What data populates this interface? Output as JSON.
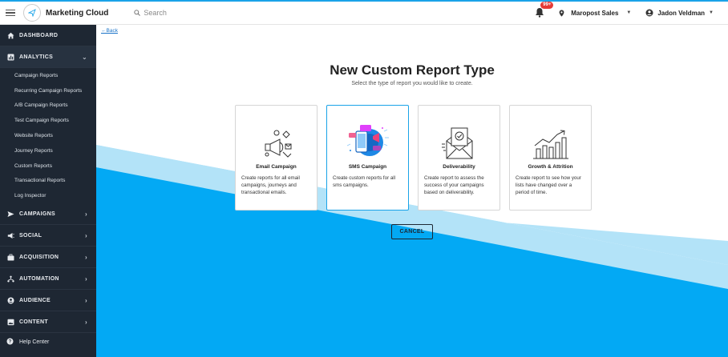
{
  "topbar": {
    "app_title": "Marketing Cloud",
    "search_placeholder": "Search",
    "notification_count": "99+",
    "account_name": "Maropost Sales",
    "user_name": "Jadon Veldman"
  },
  "sidebar": {
    "groups": [
      {
        "label": "DASHBOARD",
        "icon": "home-icon"
      },
      {
        "label": "ANALYTICS",
        "icon": "chart-icon",
        "expanded": true
      },
      {
        "label": "CAMPAIGNS",
        "icon": "send-icon"
      },
      {
        "label": "SOCIAL",
        "icon": "megaphone-icon"
      },
      {
        "label": "ACQUISITION",
        "icon": "briefcase-icon"
      },
      {
        "label": "AUTOMATION",
        "icon": "flow-icon"
      },
      {
        "label": "AUDIENCE",
        "icon": "person-icon"
      },
      {
        "label": "CONTENT",
        "icon": "image-icon"
      }
    ],
    "analytics_items": [
      "Campaign Reports",
      "Recurring Campaign Reports",
      "A/B Campaign Reports",
      "Test Campaign Reports",
      "Website Reports",
      "Journey Reports",
      "Custom Reports",
      "Transactional Reports",
      "Log Inspector"
    ],
    "help_label": "Help Center"
  },
  "main": {
    "back_label": "Back",
    "title": "New Custom Report Type",
    "subtitle": "Select the type of report you would like to create.",
    "cards": [
      {
        "title": "Email Campaign",
        "description": "Create reports for all email campaigns, journeys and transactional emails.",
        "icon": "email-campaign-icon"
      },
      {
        "title": "SMS Campaign",
        "description": "Create custom reports for all sms campaigns.",
        "icon": "sms-campaign-icon",
        "selected": true
      },
      {
        "title": "Deliverability",
        "description": "Create report to assess the success of your campaigns based on deliverability.",
        "icon": "deliverability-icon"
      },
      {
        "title": "Growth & Attrition",
        "description": "Create report to see how your lists have changed over a period of time.",
        "icon": "growth-chart-icon"
      }
    ],
    "cancel_label": "CANCEL"
  },
  "colors": {
    "accent": "#1aa3e8",
    "sidebar_bg": "#1e2733",
    "wave_light": "#b3e3f8",
    "wave_dark": "#03a9f4",
    "badge": "#e53935"
  }
}
